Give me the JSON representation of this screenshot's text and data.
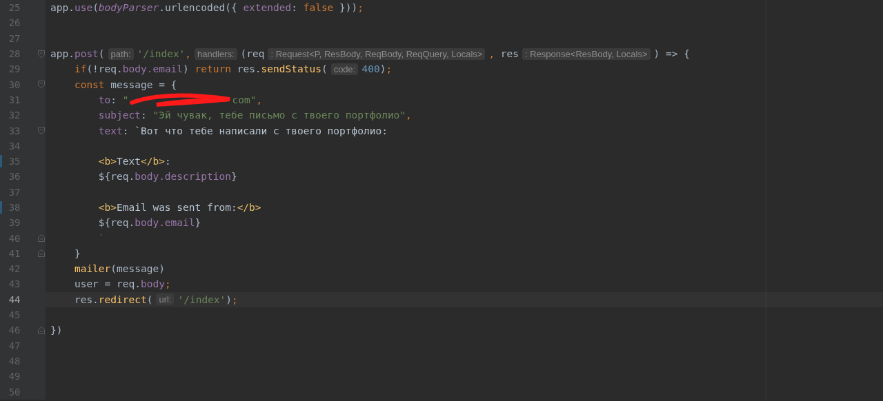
{
  "editor": {
    "lines": [
      {
        "number": "25",
        "fold_start": false,
        "fold_end": false,
        "current": false,
        "changed": false,
        "tokens": [
          {
            "kind": "plain",
            "text": "app."
          },
          {
            "kind": "prop",
            "text": "use"
          },
          {
            "kind": "plain",
            "text": "("
          },
          {
            "kind": "static",
            "text": "bodyParser"
          },
          {
            "kind": "plain",
            "text": ".urlencoded({ "
          },
          {
            "kind": "prop",
            "text": "extended"
          },
          {
            "kind": "plain",
            "text": ": "
          },
          {
            "kind": "kw",
            "text": "false"
          },
          {
            "kind": "plain",
            "text": " }))"
          },
          {
            "kind": "kw",
            "text": ";"
          }
        ]
      },
      {
        "number": "26",
        "fold_start": false,
        "fold_end": false,
        "current": false,
        "changed": false
      },
      {
        "number": "27",
        "fold_start": false,
        "fold_end": false,
        "current": false,
        "changed": false
      },
      {
        "number": "28",
        "fold_start": true,
        "fold_end": false,
        "current": false,
        "changed": false,
        "tokens": [
          {
            "kind": "plain",
            "text": "app."
          },
          {
            "kind": "prop",
            "text": "post"
          },
          {
            "kind": "plain",
            "text": "("
          },
          {
            "kind": "hint",
            "text": "path:"
          },
          {
            "kind": "str",
            "text": "'/index'"
          },
          {
            "kind": "kw",
            "text": ","
          },
          {
            "kind": "hint",
            "text": "handlers:"
          },
          {
            "kind": "plain",
            "text": "(req"
          },
          {
            "kind": "hint",
            "text": ": Request<P, ResBody, ReqBody, ReqQuery, Locals>"
          },
          {
            "kind": "kw",
            "text": ","
          },
          {
            "kind": "plain",
            "text": " res"
          },
          {
            "kind": "hint",
            "text": ": Response<ResBody, Locals>"
          },
          {
            "kind": "plain",
            "text": ") => {"
          }
        ]
      },
      {
        "number": "29",
        "fold_start": false,
        "fold_end": false,
        "current": false,
        "changed": false,
        "tokens": [
          {
            "kind": "kw",
            "text": "    if"
          },
          {
            "kind": "plain",
            "text": "(!req."
          },
          {
            "kind": "prop",
            "text": "body.email"
          },
          {
            "kind": "plain",
            "text": ") "
          },
          {
            "kind": "kw",
            "text": "return "
          },
          {
            "kind": "plain",
            "text": "res."
          },
          {
            "kind": "fn",
            "text": "sendStatus"
          },
          {
            "kind": "plain",
            "text": "("
          },
          {
            "kind": "hint",
            "text": "code:"
          },
          {
            "kind": "num",
            "text": "400"
          },
          {
            "kind": "plain",
            "text": ")"
          },
          {
            "kind": "kw",
            "text": ";"
          }
        ]
      },
      {
        "number": "30",
        "fold_start": true,
        "fold_end": false,
        "current": false,
        "changed": false,
        "tokens": [
          {
            "kind": "kw",
            "text": "    const "
          },
          {
            "kind": "plain",
            "text": "message = {"
          }
        ]
      },
      {
        "number": "31",
        "fold_start": false,
        "fold_end": false,
        "current": false,
        "changed": false,
        "tokens": [
          {
            "kind": "prop",
            "text": "        to"
          },
          {
            "kind": "plain",
            "text": ": "
          },
          {
            "kind": "str",
            "text": "\""
          },
          {
            "kind": "redacted"
          },
          {
            "kind": "str",
            "text": "com\""
          },
          {
            "kind": "kw",
            "text": ","
          }
        ]
      },
      {
        "number": "32",
        "fold_start": false,
        "fold_end": false,
        "current": false,
        "changed": false,
        "tokens": [
          {
            "kind": "prop",
            "text": "        subject"
          },
          {
            "kind": "plain",
            "text": ": "
          },
          {
            "kind": "str",
            "text": "\"Эй чувак, тебе письмо с твоего портфолио\""
          },
          {
            "kind": "kw",
            "text": ","
          }
        ]
      },
      {
        "number": "33",
        "fold_start": true,
        "fold_end": false,
        "current": false,
        "changed": false,
        "tokens": [
          {
            "kind": "prop",
            "text": "        text"
          },
          {
            "kind": "plain",
            "text": ": "
          },
          {
            "kind": "tpl",
            "text": "`Вот что тебе написали с твоего портфолио:"
          }
        ]
      },
      {
        "number": "34",
        "fold_start": false,
        "fold_end": false,
        "current": false,
        "changed": false
      },
      {
        "number": "35",
        "fold_start": false,
        "fold_end": false,
        "current": false,
        "changed": true,
        "tokens": [
          {
            "kind": "tag",
            "text": "        <b>"
          },
          {
            "kind": "tpl",
            "text": "Text"
          },
          {
            "kind": "tag",
            "text": "</b>"
          },
          {
            "kind": "tpl",
            "text": ":"
          }
        ]
      },
      {
        "number": "36",
        "fold_start": false,
        "fold_end": false,
        "current": false,
        "changed": false,
        "tokens": [
          {
            "kind": "plain",
            "text": "        ${req."
          },
          {
            "kind": "prop",
            "text": "body.description"
          },
          {
            "kind": "plain",
            "text": "}"
          }
        ]
      },
      {
        "number": "37",
        "fold_start": false,
        "fold_end": false,
        "current": false,
        "changed": false
      },
      {
        "number": "38",
        "fold_start": false,
        "fold_end": false,
        "current": false,
        "changed": true,
        "tokens": [
          {
            "kind": "tag",
            "text": "        <b>"
          },
          {
            "kind": "tpl",
            "text": "Email was sent from:"
          },
          {
            "kind": "tag",
            "text": "</b>"
          }
        ]
      },
      {
        "number": "39",
        "fold_start": false,
        "fold_end": false,
        "current": false,
        "changed": false,
        "tokens": [
          {
            "kind": "plain",
            "text": "        ${req."
          },
          {
            "kind": "prop",
            "text": "body.email"
          },
          {
            "kind": "plain",
            "text": "}"
          }
        ]
      },
      {
        "number": "40",
        "fold_start": false,
        "fold_end": true,
        "current": false,
        "changed": false,
        "tokens": [
          {
            "kind": "faint",
            "text": "        `"
          }
        ]
      },
      {
        "number": "41",
        "fold_start": false,
        "fold_end": true,
        "current": false,
        "changed": false,
        "tokens": [
          {
            "kind": "plain",
            "text": "    }"
          }
        ]
      },
      {
        "number": "42",
        "fold_start": false,
        "fold_end": false,
        "current": false,
        "changed": false,
        "tokens": [
          {
            "kind": "fn",
            "text": "    mailer"
          },
          {
            "kind": "plain",
            "text": "(message)"
          }
        ]
      },
      {
        "number": "43",
        "fold_start": false,
        "fold_end": false,
        "current": false,
        "changed": false,
        "tokens": [
          {
            "kind": "plain",
            "text": "    user = req."
          },
          {
            "kind": "prop",
            "text": "body"
          },
          {
            "kind": "kw",
            "text": ";"
          }
        ]
      },
      {
        "number": "44",
        "fold_start": false,
        "fold_end": false,
        "current": true,
        "changed": false,
        "tokens": [
          {
            "kind": "plain",
            "text": "    res."
          },
          {
            "kind": "fn",
            "text": "redirect"
          },
          {
            "kind": "plain",
            "text": "("
          },
          {
            "kind": "hint",
            "text": "url:"
          },
          {
            "kind": "str",
            "text": "'/index'"
          },
          {
            "kind": "plain",
            "text": ")"
          },
          {
            "kind": "kw",
            "text": ";"
          }
        ]
      },
      {
        "number": "45",
        "fold_start": false,
        "fold_end": false,
        "current": false,
        "changed": false
      },
      {
        "number": "46",
        "fold_start": false,
        "fold_end": true,
        "current": false,
        "changed": false,
        "tokens": [
          {
            "kind": "plain",
            "text": "})"
          }
        ]
      },
      {
        "number": "47",
        "fold_start": false,
        "fold_end": false,
        "current": false,
        "changed": false
      },
      {
        "number": "48",
        "fold_start": false,
        "fold_end": false,
        "current": false,
        "changed": false
      },
      {
        "number": "49",
        "fold_start": false,
        "fold_end": false,
        "current": false,
        "changed": false
      },
      {
        "number": "50",
        "fold_start": false,
        "fold_end": false,
        "current": false,
        "changed": false
      }
    ]
  }
}
